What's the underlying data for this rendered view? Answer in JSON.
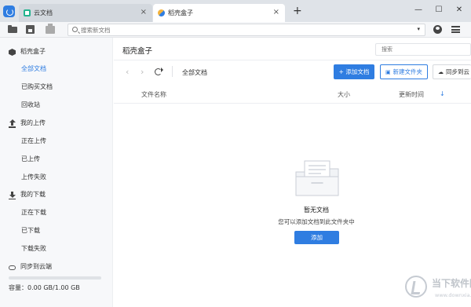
{
  "tabs": [
    {
      "label": "云文档",
      "icon": "doc-icon",
      "close": "×"
    },
    {
      "label": "稻壳盒子",
      "icon": "box-icon",
      "close": "×"
    }
  ],
  "new_tab": "+",
  "window_controls": {
    "minimize": "—",
    "maximize": "☐",
    "close": "✕"
  },
  "toolbar": {
    "search_placeholder": "搜索新文档",
    "search_caret": "▾"
  },
  "sidebar": {
    "sections": [
      {
        "title": "稻壳盒子",
        "icon": "box-icon",
        "items": [
          "全部文档",
          "已购买文档",
          "回收站"
        ]
      },
      {
        "title": "我的上传",
        "icon": "upload-icon",
        "items": [
          "正在上传",
          "已上传",
          "上传失败"
        ]
      },
      {
        "title": "我的下载",
        "icon": "download-icon",
        "items": [
          "正在下载",
          "已下载",
          "下载失败"
        ]
      },
      {
        "title": "同步到云端",
        "icon": "cloud-icon",
        "items": []
      }
    ],
    "active_item": "全部文档",
    "storage": {
      "text": "容量：0.00 GB/1.00 GB",
      "used_fraction": 0.0
    }
  },
  "main": {
    "title": "稻壳盒子",
    "search_placeholder": "搜索",
    "nav": {
      "back": "‹",
      "forward": "›"
    },
    "breadcrumb": "全部文档",
    "buttons": {
      "add": "+ 添加文档",
      "new_folder": "新建文件夹",
      "sync": "同步到云"
    },
    "columns": {
      "name": "文件名称",
      "size": "大小",
      "updated": "更新时间",
      "sort": "↓"
    },
    "empty": {
      "title": "暂无文档",
      "desc": "您可以添加文档到此文件夹中",
      "button": "添加"
    }
  },
  "watermark": {
    "text": "当下软件园",
    "url": "www.downxia.com"
  },
  "colors": {
    "accent": "#2f7de1",
    "sidebar_bg": "#f7f8fa",
    "tabbar_bg": "#dfe3e8"
  }
}
